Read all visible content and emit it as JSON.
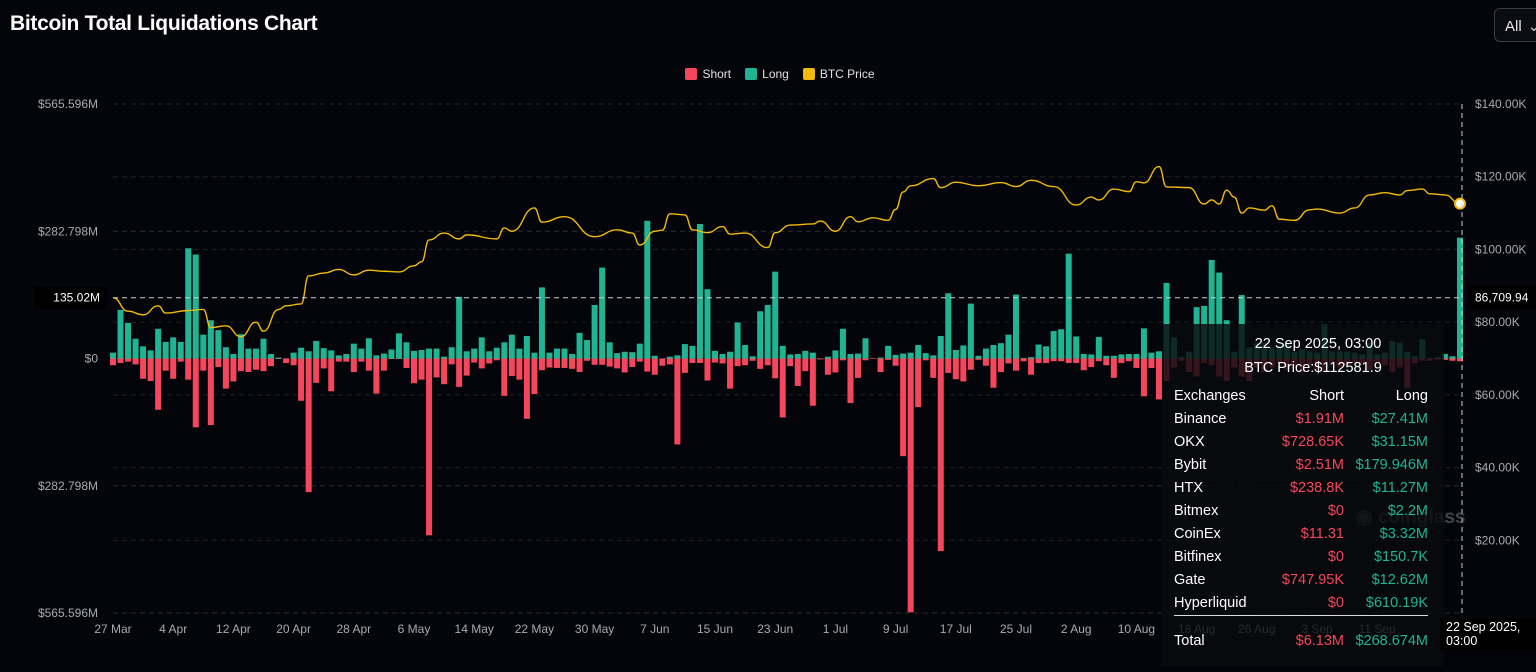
{
  "header": {
    "title": "Bitcoin Total Liquidations Chart",
    "range_button": "All"
  },
  "colors": {
    "short": "#f6465d",
    "long": "#1fb494",
    "price": "#f0b90b",
    "background": "#04050a"
  },
  "chart_data": {
    "type": "bar+line",
    "title": "Bitcoin Total Liquidations Chart",
    "legend": {
      "placement": "top-center",
      "entries": [
        "Short",
        "Long",
        "BTC Price"
      ]
    },
    "x_range": [
      "2025-03-27",
      "2025-09-22"
    ],
    "x_ticks": [
      "27 Mar",
      "4 Apr",
      "12 Apr",
      "20 Apr",
      "28 Apr",
      "6 May",
      "14 May",
      "22 May",
      "30 May",
      "7 Jun",
      "15 Jun",
      "23 Jun",
      "1 Jul",
      "9 Jul",
      "17 Jul",
      "25 Jul",
      "2 Aug",
      "10 Aug",
      "18 Aug",
      "26 Aug",
      "3 Sep",
      "11 Sep",
      "22 Sep"
    ],
    "y_left": {
      "unit": "USD millions",
      "range": [
        -565.596,
        565.596
      ],
      "ticks": [
        "$565.596M",
        "$282.798M",
        "$0",
        "$282.798M",
        "$565.596M"
      ],
      "tick_values": [
        565.596,
        282.798,
        0,
        -282.798,
        -565.596
      ]
    },
    "y_right": {
      "unit": "USD",
      "range": [
        0,
        140000
      ],
      "ticks": [
        "$140.00K",
        "$120.00K",
        "$100.00K",
        "$80.00K",
        "$60.00K",
        "$40.00K",
        "$20.00K"
      ],
      "tick_values": [
        140000,
        120000,
        100000,
        80000,
        60000,
        40000,
        20000
      ]
    },
    "grid": true,
    "crosshair": {
      "left_label": "135.02M",
      "right_label": "86,709.94",
      "x_label": "22 Sep 2025, 03:00",
      "left_value": 135.02
    },
    "series": [
      {
        "name": "Long",
        "axis": "left",
        "values": [
          13,
          108,
          79,
          44,
          27,
          18,
          66,
          37,
          47,
          37,
          245,
          231,
          53,
          85,
          63,
          25,
          10,
          54,
          22,
          22,
          44,
          10,
          2,
          0,
          13,
          24,
          16,
          39,
          23,
          18,
          7,
          10,
          33,
          22,
          45,
          7,
          11,
          20,
          56,
          36,
          17,
          19,
          22,
          22,
          4,
          25,
          137,
          16,
          22,
          47,
          16,
          24,
          36,
          53,
          22,
          50,
          13,
          158,
          13,
          22,
          22,
          10,
          57,
          41,
          119,
          202,
          36,
          12,
          15,
          14,
          33,
          306,
          6,
          0,
          4,
          7,
          32,
          28,
          299,
          154,
          17,
          10,
          15,
          80,
          30,
          5,
          105,
          119,
          193,
          28,
          9,
          10,
          17,
          13,
          0,
          4,
          18,
          66,
          10,
          11,
          45,
          0,
          2,
          28,
          8,
          11,
          13,
          30,
          12,
          7,
          50,
          145,
          19,
          29,
          122,
          6,
          22,
          30,
          34,
          53,
          142,
          1,
          3,
          31,
          27,
          61,
          65,
          233,
          49,
          10,
          9,
          48,
          6,
          6,
          9,
          10,
          10,
          67,
          13,
          16,
          168,
          47,
          3,
          15,
          114,
          117,
          219,
          191,
          85,
          15,
          141,
          24,
          35,
          35,
          25,
          25,
          35,
          15,
          21,
          16,
          13,
          76,
          16,
          16,
          15,
          13,
          9,
          35,
          9,
          13,
          39,
          35,
          15,
          5,
          43,
          1,
          3,
          10,
          5,
          268.674
        ]
      },
      {
        "name": "Short",
        "axis": "left",
        "values": [
          15,
          10,
          7,
          13,
          45,
          50,
          114,
          27,
          45,
          7,
          47,
          153,
          27,
          148,
          19,
          67,
          51,
          28,
          30,
          25,
          28,
          17,
          1,
          10,
          15,
          94,
          297,
          54,
          22,
          73,
          7,
          7,
          30,
          7,
          27,
          78,
          27,
          1,
          1,
          21,
          55,
          47,
          393,
          42,
          57,
          13,
          63,
          38,
          9,
          22,
          11,
          4,
          83,
          39,
          47,
          134,
          79,
          26,
          20,
          21,
          21,
          23,
          30,
          5,
          14,
          14,
          18,
          22,
          31,
          19,
          7,
          29,
          36,
          16,
          13,
          191,
          32,
          10,
          10,
          49,
          9,
          11,
          67,
          17,
          15,
          5,
          23,
          15,
          44,
          131,
          17,
          61,
          28,
          105,
          2,
          36,
          31,
          4,
          99,
          43,
          4,
          1,
          30,
          3,
          16,
          217,
          564,
          108,
          4,
          43,
          428,
          32,
          46,
          51,
          25,
          3,
          16,
          65,
          30,
          11,
          27,
          6,
          36,
          10,
          10,
          6,
          6,
          10,
          10,
          26,
          19,
          6,
          15,
          43,
          10,
          6,
          21,
          84,
          21,
          91,
          50,
          20,
          5,
          30,
          40,
          10,
          15,
          40,
          50,
          20,
          40,
          50,
          20,
          30,
          20,
          10,
          25,
          20,
          30,
          15,
          25,
          30,
          10,
          20,
          15,
          10,
          10,
          25,
          10,
          15,
          30,
          20,
          65,
          10,
          5,
          5,
          3,
          3,
          5,
          6.13
        ]
      },
      {
        "name": "BTC Price",
        "axis": "right",
        "points": [
          [
            "2025-03-27",
            86700
          ],
          [
            "2025-03-29",
            83000
          ],
          [
            "2025-03-31",
            82000
          ],
          [
            "2025-04-02",
            84500
          ],
          [
            "2025-04-03",
            82500
          ],
          [
            "2025-04-06",
            83200
          ],
          [
            "2025-04-08",
            83500
          ],
          [
            "2025-04-09",
            78500
          ],
          [
            "2025-04-11",
            79000
          ],
          [
            "2025-04-13",
            76000
          ],
          [
            "2025-04-15",
            80000
          ],
          [
            "2025-04-16",
            77500
          ],
          [
            "2025-04-18",
            83500
          ],
          [
            "2025-04-19",
            84500
          ],
          [
            "2025-04-21",
            85000
          ],
          [
            "2025-04-22",
            92700
          ],
          [
            "2025-04-24",
            93500
          ],
          [
            "2025-04-26",
            94500
          ],
          [
            "2025-04-28",
            93000
          ],
          [
            "2025-04-30",
            94300
          ],
          [
            "2025-05-02",
            94000
          ],
          [
            "2025-05-04",
            93800
          ],
          [
            "2025-05-06",
            95500
          ],
          [
            "2025-05-07",
            96600
          ],
          [
            "2025-05-08",
            102600
          ],
          [
            "2025-05-10",
            104500
          ],
          [
            "2025-05-12",
            102900
          ],
          [
            "2025-05-13",
            104000
          ],
          [
            "2025-05-17",
            102900
          ],
          [
            "2025-05-18",
            105900
          ],
          [
            "2025-05-19",
            105000
          ],
          [
            "2025-05-22",
            111400
          ],
          [
            "2025-05-23",
            107500
          ],
          [
            "2025-05-26",
            109000
          ],
          [
            "2025-05-30",
            103500
          ],
          [
            "2025-06-02",
            105400
          ],
          [
            "2025-06-04",
            104500
          ],
          [
            "2025-06-05",
            101200
          ],
          [
            "2025-06-07",
            105000
          ],
          [
            "2025-06-08",
            105300
          ],
          [
            "2025-06-09",
            109800
          ],
          [
            "2025-06-11",
            109500
          ],
          [
            "2025-06-12",
            105400
          ],
          [
            "2025-06-14",
            104600
          ],
          [
            "2025-06-16",
            106300
          ],
          [
            "2025-06-17",
            104200
          ],
          [
            "2025-06-19",
            104500
          ],
          [
            "2025-06-22",
            100500
          ],
          [
            "2025-06-23",
            104600
          ],
          [
            "2025-06-25",
            106700
          ],
          [
            "2025-06-28",
            107000
          ],
          [
            "2025-06-29",
            107800
          ],
          [
            "2025-07-01",
            105000
          ],
          [
            "2025-07-03",
            109000
          ],
          [
            "2025-07-04",
            107600
          ],
          [
            "2025-07-06",
            108700
          ],
          [
            "2025-07-08",
            108000
          ],
          [
            "2025-07-09",
            111000
          ],
          [
            "2025-07-10",
            115800
          ],
          [
            "2025-07-11",
            117500
          ],
          [
            "2025-07-14",
            119500
          ],
          [
            "2025-07-15",
            117000
          ],
          [
            "2025-07-17",
            118500
          ],
          [
            "2025-07-20",
            117500
          ],
          [
            "2025-07-23",
            118400
          ],
          [
            "2025-07-25",
            117300
          ],
          [
            "2025-07-27",
            119000
          ],
          [
            "2025-07-30",
            117300
          ],
          [
            "2025-08-02",
            112200
          ],
          [
            "2025-08-04",
            114400
          ],
          [
            "2025-08-05",
            113600
          ],
          [
            "2025-08-07",
            116600
          ],
          [
            "2025-08-09",
            115900
          ],
          [
            "2025-08-10",
            118600
          ],
          [
            "2025-08-11",
            118300
          ],
          [
            "2025-08-13",
            122800
          ],
          [
            "2025-08-14",
            117200
          ],
          [
            "2025-08-17",
            117000
          ],
          [
            "2025-08-19",
            112500
          ],
          [
            "2025-08-20",
            113600
          ],
          [
            "2025-08-21",
            112500
          ],
          [
            "2025-08-22",
            116300
          ],
          [
            "2025-08-23",
            114400
          ],
          [
            "2025-08-24",
            110000
          ],
          [
            "2025-08-25",
            111400
          ],
          [
            "2025-08-27",
            110800
          ],
          [
            "2025-08-28",
            112000
          ],
          [
            "2025-08-29",
            108300
          ],
          [
            "2025-08-31",
            108000
          ],
          [
            "2025-09-02",
            110900
          ],
          [
            "2025-09-03",
            111100
          ],
          [
            "2025-09-06",
            110000
          ],
          [
            "2025-09-08",
            111400
          ],
          [
            "2025-09-10",
            115000
          ],
          [
            "2025-09-12",
            115600
          ],
          [
            "2025-09-14",
            115000
          ],
          [
            "2025-09-15",
            116200
          ],
          [
            "2025-09-17",
            116600
          ],
          [
            "2025-09-18",
            115300
          ],
          [
            "2025-09-20",
            115000
          ],
          [
            "2025-09-22",
            112581.9
          ]
        ]
      }
    ]
  },
  "tooltip": {
    "date": "22 Sep 2025, 03:00",
    "price": "BTC Price:$112581.9",
    "headers": [
      "Exchanges",
      "Short",
      "Long"
    ],
    "rows": [
      [
        "Binance",
        "$1.91M",
        "$27.41M"
      ],
      [
        "OKX",
        "$728.65K",
        "$31.15M"
      ],
      [
        "Bybit",
        "$2.51M",
        "$179.946M"
      ],
      [
        "HTX",
        "$238.8K",
        "$11.27M"
      ],
      [
        "Bitmex",
        "$0",
        "$2.2M"
      ],
      [
        "CoinEx",
        "$11.31",
        "$3.32M"
      ],
      [
        "Bitfinex",
        "$0",
        "$150.7K"
      ],
      [
        "Gate",
        "$747.95K",
        "$12.62M"
      ],
      [
        "Hyperliquid",
        "$0",
        "$610.19K"
      ]
    ],
    "total": [
      "Total",
      "$6.13M",
      "$268.674M"
    ]
  },
  "watermark": "coinglass"
}
